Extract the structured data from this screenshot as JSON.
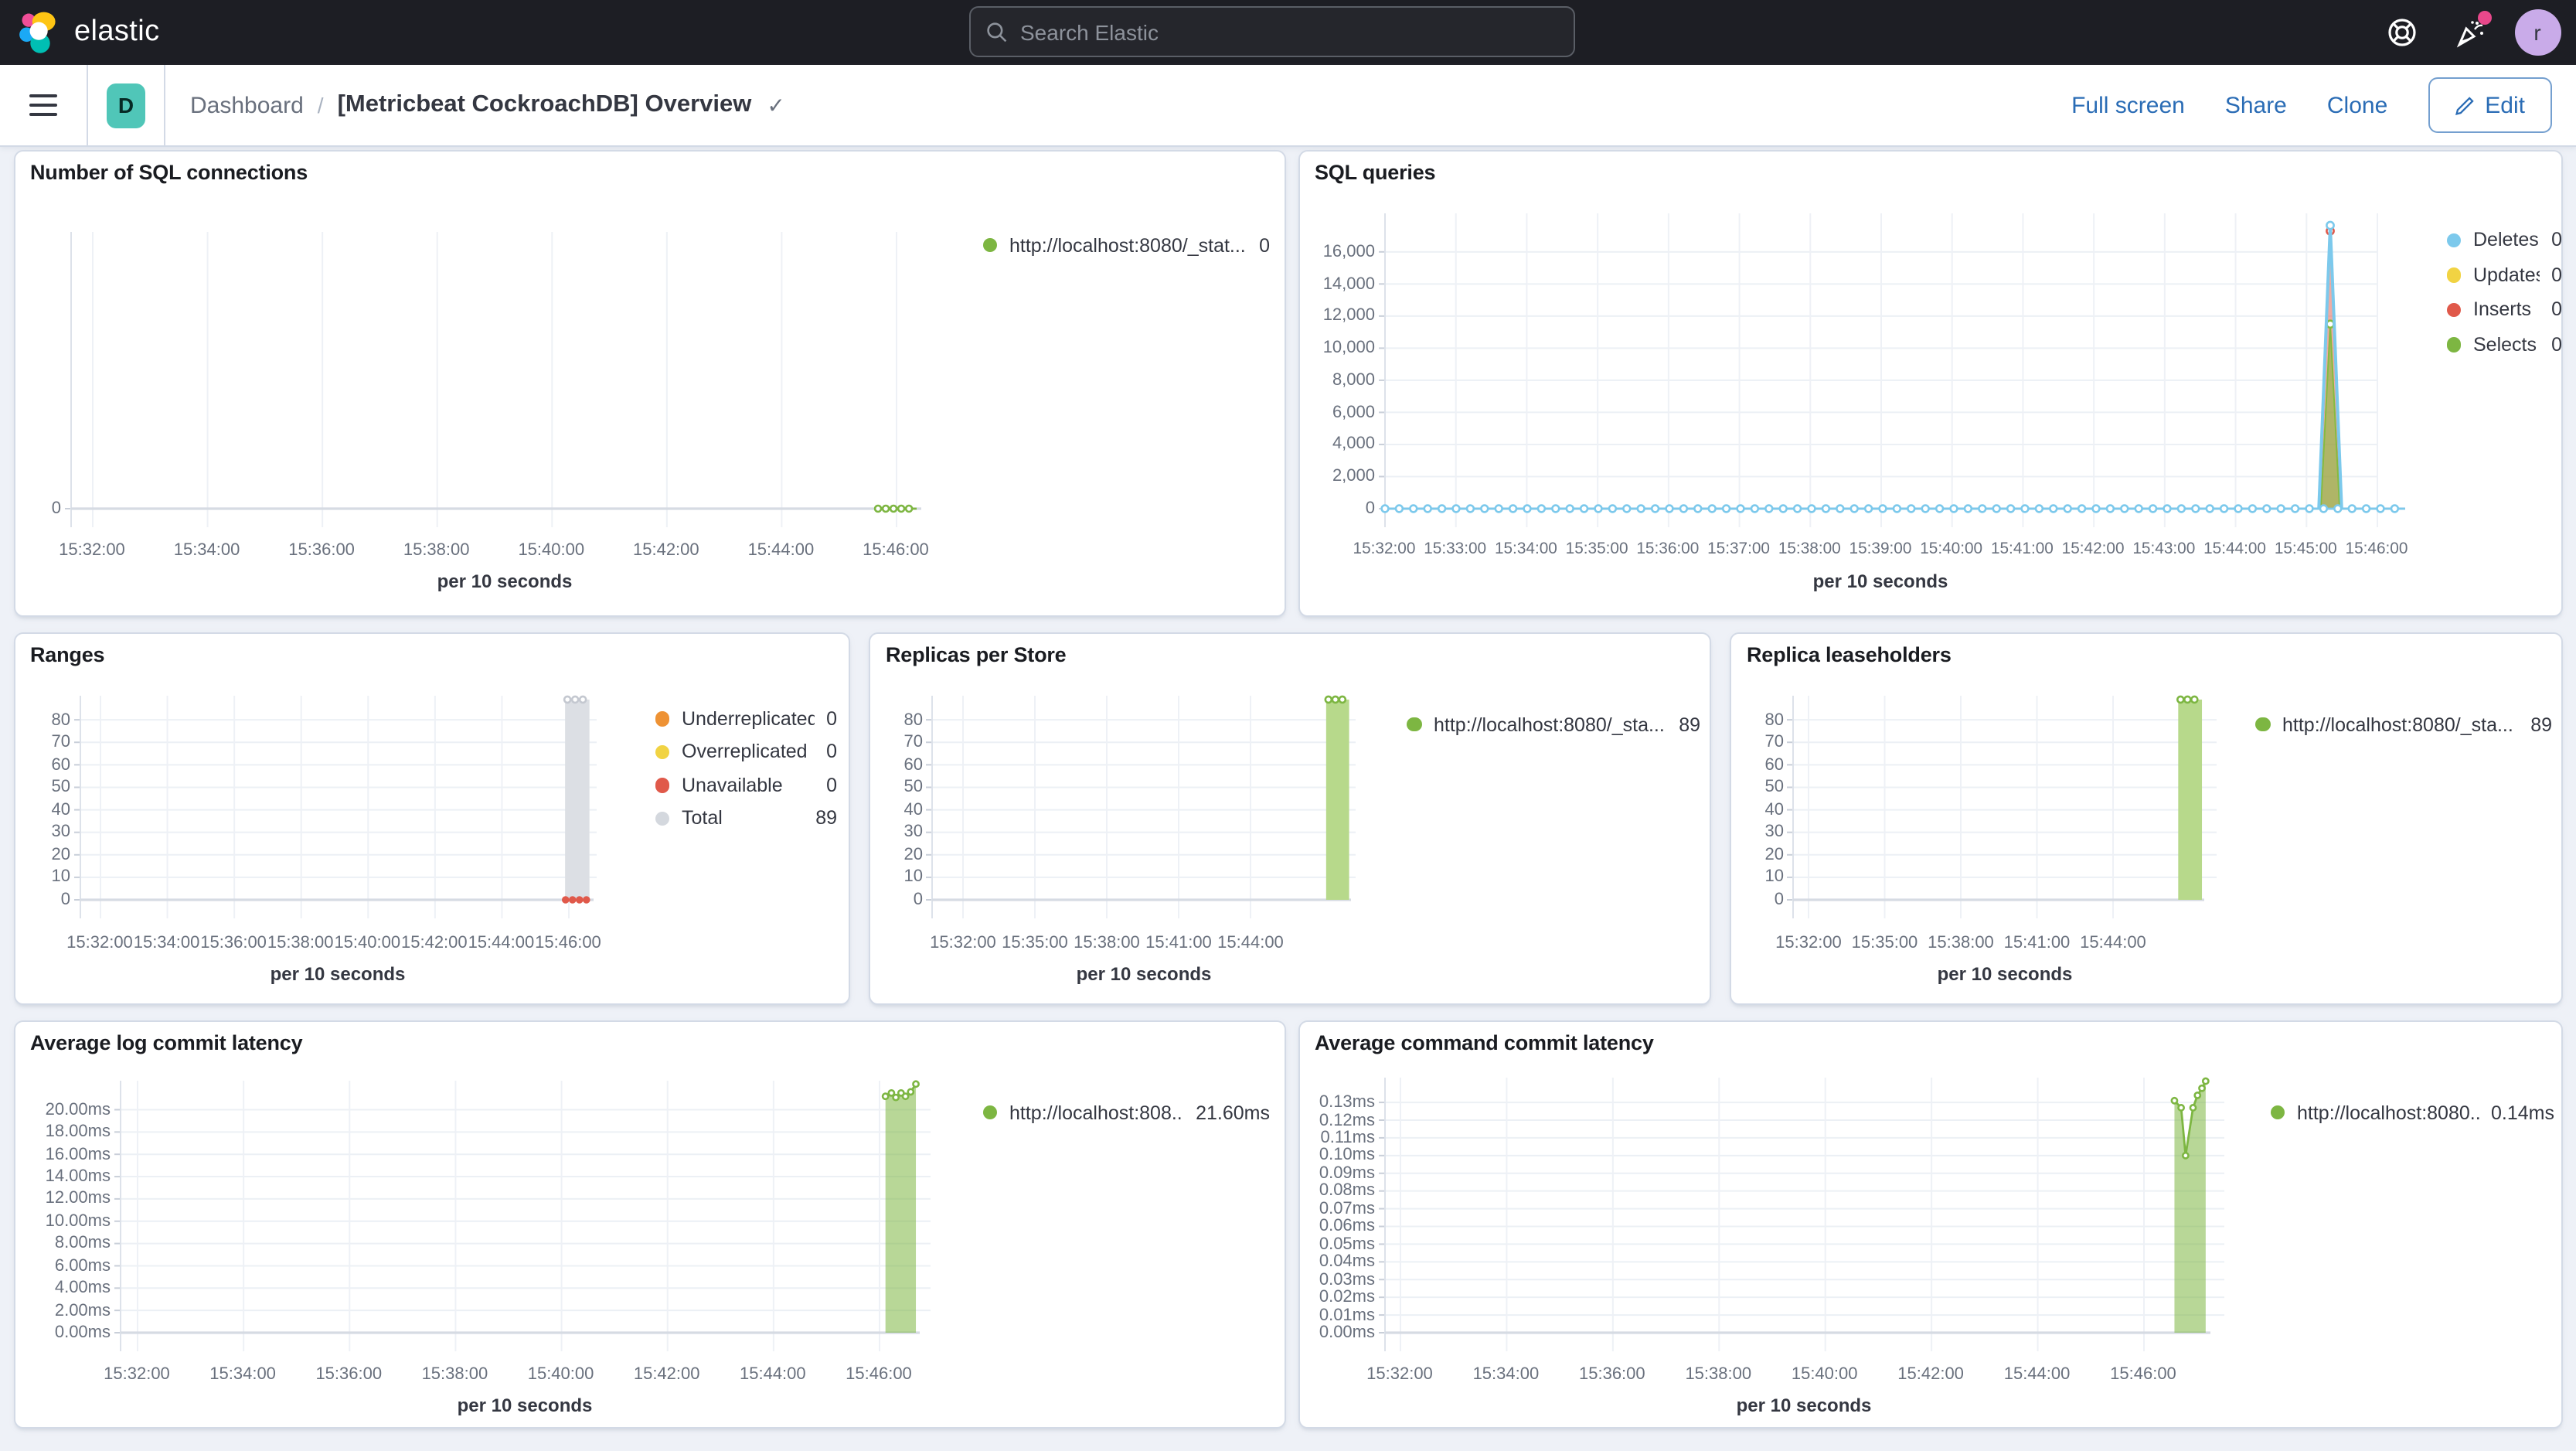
{
  "app": {
    "brand": "elastic",
    "search": {
      "placeholder": "Search Elastic"
    },
    "help_icon": "life-ring",
    "news_icon": "party-popper",
    "avatar_initial": "r"
  },
  "toolbar": {
    "menu_icon": "hamburger",
    "space_badge": "D",
    "breadcrumb": {
      "root": "Dashboard",
      "separator": "/",
      "current": "[Metricbeat CockroachDB] Overview"
    },
    "saved_check": "✓",
    "actions": {
      "full_screen": "Full screen",
      "share": "Share",
      "clone": "Clone",
      "edit": "Edit"
    }
  },
  "colors": {
    "green": "#7db642",
    "blue": "#7cc9ec",
    "yellow": "#f1d343",
    "red": "#e0594a",
    "orange": "#ee9234",
    "gray": "#d4d8de",
    "link": "#2a6cb5",
    "badge_teal": "#50c6b8"
  },
  "panels": [
    {
      "id": "sql_connections",
      "title": "Number of SQL connections",
      "legend": [
        {
          "label": "http://localhost:8080/_stat...",
          "value": "0",
          "color": "#7db642"
        }
      ],
      "chart_data": {
        "type": "line",
        "x_axis_label": "per 10 seconds",
        "x_ticks": [
          "15:32:00",
          "15:34:00",
          "15:36:00",
          "15:38:00",
          "15:40:00",
          "15:42:00",
          "15:44:00",
          "15:46:00"
        ],
        "y_ticks": [
          {
            "v": 0,
            "label": "0"
          }
        ],
        "ylim": [
          0,
          1
        ],
        "series": [
          {
            "name": "http://localhost:8080/_stat...",
            "kind": "flat_markers",
            "color": "#7db642",
            "value": 0,
            "t_from": 0.977,
            "t_to": 1.025,
            "marker_r": 2,
            "marker_gap": 5
          }
        ]
      }
    },
    {
      "id": "sql_queries",
      "title": "SQL queries",
      "legend": [
        {
          "label": "Deletes",
          "value": "0",
          "color": "#7cc9ec"
        },
        {
          "label": "Updates",
          "value": "0",
          "color": "#f1d343"
        },
        {
          "label": "Inserts",
          "value": "0",
          "color": "#e0594a"
        },
        {
          "label": "Selects",
          "value": "0",
          "color": "#7db642"
        }
      ],
      "chart_data": {
        "type": "line",
        "x_axis_label": "per 10 seconds",
        "x_ticks": [
          "15:32:00",
          "15:33:00",
          "15:34:00",
          "15:35:00",
          "15:36:00",
          "15:37:00",
          "15:38:00",
          "15:39:00",
          "15:40:00",
          "15:41:00",
          "15:42:00",
          "15:43:00",
          "15:44:00",
          "15:45:00",
          "15:46:00"
        ],
        "y_ticks": [
          {
            "v": 16000,
            "label": "16,000"
          },
          {
            "v": 14000,
            "label": "14,000"
          },
          {
            "v": 12000,
            "label": "12,000"
          },
          {
            "v": 10000,
            "label": "10,000"
          },
          {
            "v": 8000,
            "label": "8,000"
          },
          {
            "v": 6000,
            "label": "6,000"
          },
          {
            "v": 4000,
            "label": "4,000"
          },
          {
            "v": 2000,
            "label": "2,000"
          },
          {
            "v": 0,
            "label": "0"
          }
        ],
        "ylim": [
          0,
          18400
        ],
        "series": [
          {
            "name": "Inserts spike",
            "kind": "spike",
            "color": "#e0594a",
            "fill": 0.5,
            "value": 17300,
            "t_center": 0.9525,
            "t_half": 0.0105,
            "marker": true
          },
          {
            "name": "Selects spike",
            "kind": "spike",
            "color": "#84bb40",
            "fill": 0.6,
            "value": 11500,
            "t_center": 0.9525,
            "t_half": 0.0095,
            "marker": true
          },
          {
            "name": "Deletes spike",
            "kind": "spike",
            "color": "#7cc9ec",
            "fill": 0,
            "value": 17650,
            "t_center": 0.9525,
            "t_half": 0.0115,
            "marker": true,
            "width": 2
          },
          {
            "name": "Deletes baseline",
            "kind": "flat_markers",
            "color": "#7cc9ec",
            "value": 0,
            "t_from": 0,
            "t_to": 1.028,
            "marker_r": 2.2,
            "marker_gap": 9.2
          }
        ]
      }
    },
    {
      "id": "ranges",
      "title": "Ranges",
      "legend": [
        {
          "label": "Underreplicated",
          "value": "0",
          "color": "#ee9234"
        },
        {
          "label": "Overreplicated",
          "value": "0",
          "color": "#f1d343"
        },
        {
          "label": "Unavailable",
          "value": "0",
          "color": "#e0594a"
        },
        {
          "label": "Total",
          "value": "89",
          "color": "#d4d8de"
        }
      ],
      "chart_data": {
        "type": "bar",
        "x_axis_label": "per 10 seconds",
        "x_ticks": [
          "15:32:00",
          "15:34:00",
          "15:36:00",
          "15:38:00",
          "15:40:00",
          "15:42:00",
          "15:44:00",
          "15:46:00"
        ],
        "y_ticks": [
          {
            "v": 80,
            "label": "80"
          },
          {
            "v": 70,
            "label": "70"
          },
          {
            "v": 60,
            "label": "60"
          },
          {
            "v": 50,
            "label": "50"
          },
          {
            "v": 40,
            "label": "40"
          },
          {
            "v": 30,
            "label": "30"
          },
          {
            "v": 20,
            "label": "20"
          },
          {
            "v": 10,
            "label": "10"
          },
          {
            "v": 0,
            "label": "0"
          }
        ],
        "ylim": [
          0,
          90.7
        ],
        "series": [
          {
            "name": "Total",
            "kind": "bar",
            "color": "#dcdfe4",
            "value": 89,
            "t_center": 1.018,
            "t_half": 0.026,
            "top_markers": {
              "color": "#c4c8d0",
              "r": 2,
              "gap": 5
            }
          },
          {
            "name": "Unavailable",
            "kind": "flat_markers",
            "color": "#e0594a",
            "value": 0,
            "t_from": 0.993,
            "t_to": 1.043,
            "marker_r": 2.4,
            "marker_gap": 4.5,
            "filled": true,
            "noline": true
          }
        ]
      }
    },
    {
      "id": "replicas_per_store",
      "title": "Replicas per Store",
      "legend": [
        {
          "label": "http://localhost:8080/_sta...",
          "value": "89",
          "color": "#7db642"
        }
      ],
      "chart_data": {
        "type": "bar",
        "x_axis_label": "per 10 seconds",
        "x_ticks": [
          "15:32:00",
          "15:35:00",
          "15:38:00",
          "15:41:00",
          "15:44:00"
        ],
        "y_ticks": [
          {
            "v": 80,
            "label": "80"
          },
          {
            "v": 70,
            "label": "70"
          },
          {
            "v": 60,
            "label": "60"
          },
          {
            "v": 50,
            "label": "50"
          },
          {
            "v": 40,
            "label": "40"
          },
          {
            "v": 30,
            "label": "30"
          },
          {
            "v": 20,
            "label": "20"
          },
          {
            "v": 10,
            "label": "10"
          },
          {
            "v": 0,
            "label": "0"
          }
        ],
        "ylim": [
          0,
          90.7
        ],
        "series": [
          {
            "name": "http://localhost:8080/_sta...",
            "kind": "bar",
            "color": "#b7d98b",
            "value": 89,
            "t_center": 1.303,
            "t_half": 0.04,
            "top_markers": {
              "color": "#7db642",
              "r": 2,
              "gap": 4.5
            }
          }
        ]
      }
    },
    {
      "id": "replica_leaseholders",
      "title": "Replica leaseholders",
      "legend": [
        {
          "label": "http://localhost:8080/_sta...",
          "value": "89",
          "color": "#7db642"
        }
      ],
      "chart_data": {
        "type": "bar",
        "x_axis_label": "per 10 seconds",
        "x_ticks": [
          "15:32:00",
          "15:35:00",
          "15:38:00",
          "15:41:00",
          "15:44:00"
        ],
        "y_ticks": [
          {
            "v": 80,
            "label": "80"
          },
          {
            "v": 70,
            "label": "70"
          },
          {
            "v": 60,
            "label": "60"
          },
          {
            "v": 50,
            "label": "50"
          },
          {
            "v": 40,
            "label": "40"
          },
          {
            "v": 30,
            "label": "30"
          },
          {
            "v": 20,
            "label": "20"
          },
          {
            "v": 10,
            "label": "10"
          },
          {
            "v": 0,
            "label": "0"
          }
        ],
        "ylim": [
          0,
          90.7
        ],
        "series": [
          {
            "name": "http://localhost:8080/_sta...",
            "kind": "bar",
            "color": "#b7d98b",
            "value": 89,
            "t_center": 1.253,
            "t_half": 0.039,
            "top_markers": {
              "color": "#7db642",
              "r": 2,
              "gap": 4.5
            }
          }
        ]
      }
    },
    {
      "id": "avg_log_commit_latency",
      "title": "Average log commit latency",
      "legend": [
        {
          "label": "http://localhost:808...",
          "value": "21.60ms",
          "color": "#7db642"
        }
      ],
      "chart_data": {
        "type": "area",
        "x_axis_label": "per 10 seconds",
        "x_ticks": [
          "15:32:00",
          "15:34:00",
          "15:36:00",
          "15:38:00",
          "15:40:00",
          "15:42:00",
          "15:44:00",
          "15:46:00"
        ],
        "y_ticks": [
          {
            "v": 20,
            "label": "20.00ms"
          },
          {
            "v": 18,
            "label": "18.00ms"
          },
          {
            "v": 16,
            "label": "16.00ms"
          },
          {
            "v": 14,
            "label": "14.00ms"
          },
          {
            "v": 12,
            "label": "12.00ms"
          },
          {
            "v": 10,
            "label": "10.00ms"
          },
          {
            "v": 8,
            "label": "8.00ms"
          },
          {
            "v": 6,
            "label": "6.00ms"
          },
          {
            "v": 4,
            "label": "4.00ms"
          },
          {
            "v": 2,
            "label": "2.00ms"
          },
          {
            "v": 0,
            "label": "0.00ms"
          }
        ],
        "ylim": [
          0,
          22.6
        ],
        "series": [
          {
            "name": "http://localhost:808...",
            "kind": "area",
            "color": "#7db642",
            "fill": 0.55,
            "marker_r": 1.8,
            "points": [
              [
                1.008,
                21.2
              ],
              [
                1.016,
                21.5
              ],
              [
                1.022,
                21.1
              ],
              [
                1.029,
                21.5
              ],
              [
                1.035,
                21.2
              ],
              [
                1.042,
                21.6
              ],
              [
                1.049,
                22.3
              ]
            ]
          }
        ]
      }
    },
    {
      "id": "avg_command_commit_latency",
      "title": "Average command commit latency",
      "legend": [
        {
          "label": "http://localhost:8080...",
          "value": "0.14ms",
          "color": "#7db642"
        }
      ],
      "chart_data": {
        "type": "area",
        "x_axis_label": "per 10 seconds",
        "x_ticks": [
          "15:32:00",
          "15:34:00",
          "15:36:00",
          "15:38:00",
          "15:40:00",
          "15:42:00",
          "15:44:00",
          "15:46:00"
        ],
        "y_ticks": [
          {
            "v": 0.13,
            "label": "0.13ms"
          },
          {
            "v": 0.12,
            "label": "0.12ms"
          },
          {
            "v": 0.11,
            "label": "0.11ms"
          },
          {
            "v": 0.1,
            "label": "0.10ms"
          },
          {
            "v": 0.09,
            "label": "0.09ms"
          },
          {
            "v": 0.08,
            "label": "0.08ms"
          },
          {
            "v": 0.07,
            "label": "0.07ms"
          },
          {
            "v": 0.06,
            "label": "0.06ms"
          },
          {
            "v": 0.05,
            "label": "0.05ms"
          },
          {
            "v": 0.04,
            "label": "0.04ms"
          },
          {
            "v": 0.03,
            "label": "0.03ms"
          },
          {
            "v": 0.02,
            "label": "0.02ms"
          },
          {
            "v": 0.01,
            "label": "0.01ms"
          },
          {
            "v": 0,
            "label": "0.00ms"
          }
        ],
        "ylim": [
          0,
          0.144
        ],
        "series": [
          {
            "name": "http://localhost:8080...",
            "kind": "area",
            "color": "#7db642",
            "fill": 0.55,
            "marker_r": 1.8,
            "points": [
              [
                1.041,
                0.131
              ],
              [
                1.05,
                0.127
              ],
              [
                1.056,
                0.1
              ],
              [
                1.066,
                0.127
              ],
              [
                1.072,
                0.134
              ],
              [
                1.078,
                0.138
              ],
              [
                1.083,
                0.142
              ]
            ]
          }
        ]
      }
    }
  ]
}
